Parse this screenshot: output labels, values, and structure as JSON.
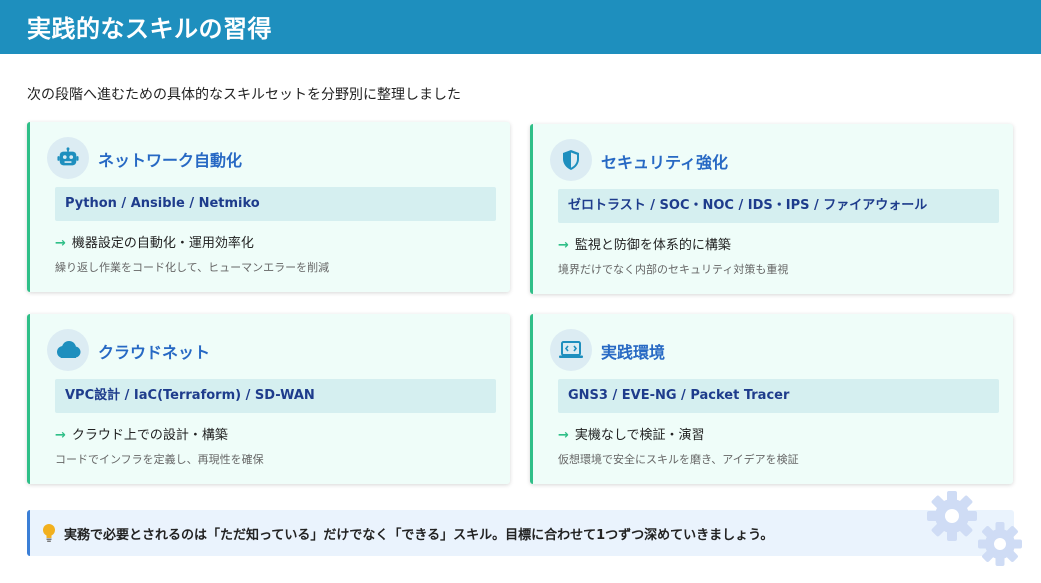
{
  "header": {
    "title": "実践的なスキルの習得"
  },
  "intro": "次の段階へ進むための具体的なスキルセットを分野別に整理しました",
  "cards": [
    {
      "title": "ネットワーク自動化",
      "icon": "robot-icon",
      "tags": "Python / Ansible / Netmiko",
      "point": "機器設定の自動化・運用効率化",
      "desc": "繰り返し作業をコード化して、ヒューマンエラーを削減"
    },
    {
      "title": "セキュリティ強化",
      "icon": "shield-icon",
      "tags": "ゼロトラスト / SOC・NOC / IDS・IPS / ファイアウォール",
      "point": "監視と防御を体系的に構築",
      "desc": "境界だけでなく内部のセキュリティ対策も重視"
    },
    {
      "title": "クラウドネット",
      "icon": "cloud-icon",
      "tags": "VPC設計 / IaC(Terraform) / SD-WAN",
      "point": "クラウド上での設計・構築",
      "desc": "コードでインフラを定義し、再現性を確保"
    },
    {
      "title": "実践環境",
      "icon": "laptop-code-icon",
      "tags": "GNS3 / EVE-NG / Packet Tracer",
      "point": "実機なしで検証・演習",
      "desc": "仮想環境で安全にスキルを磨き、アイデアを検証"
    }
  ],
  "note": {
    "icon": "lightbulb-icon",
    "text": "実務で必要とされるのは「ただ知っている」だけでなく「できる」スキル。目標に合わせて1つずつ深めていきましょう。"
  },
  "colors": {
    "header_bg": "#1e8fbe",
    "card_bg": "#effdf9",
    "card_accent": "#2fbf88",
    "title_blue": "#2769c4",
    "tag_bg": "#d5eff0",
    "note_bg": "#eaf3fd",
    "note_accent": "#3b7fd6"
  }
}
